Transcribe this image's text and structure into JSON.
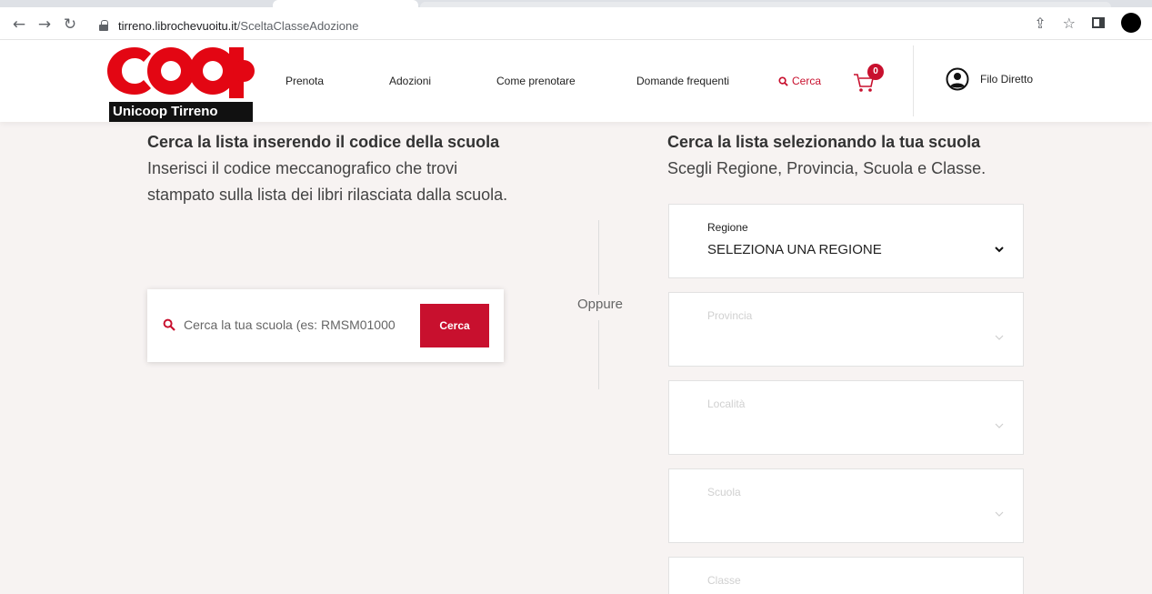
{
  "browser": {
    "url_host": "tirreno.librochevuoitu.it",
    "url_path": "/SceltaClasseAdozione",
    "back_icon": "arrow-left-icon",
    "forward_icon": "arrow-right-icon",
    "reload_icon": "reload-icon"
  },
  "header": {
    "logo_text": "coop",
    "logo_sub": "Unicoop Tirreno",
    "nav": {
      "prenota": "Prenota",
      "adozioni": "Adozioni",
      "come_prenotare": "Come prenotare",
      "domande": "Domande frequenti",
      "cerca": "Cerca"
    },
    "cart_count": "0",
    "filo_diretto": "Filo Diretto"
  },
  "left": {
    "title": "Cerca la lista inserendo il codice della scuola",
    "description": "Inserisci il codice meccanografico che trovi stampato sulla lista dei libri rilasciata dalla scuola.",
    "search_placeholder": "Cerca la tua scuola (es: RMSM01000",
    "search_button": "Cerca"
  },
  "divider": {
    "oppure": "Oppure"
  },
  "right": {
    "title": "Cerca la lista selezionando la tua scuola",
    "subtitle": "Scegli Regione, Provincia, Scuola e Classe.",
    "selects": [
      {
        "label": "Regione",
        "value": "SELEZIONA UNA REGIONE"
      },
      {
        "label": "Provincia",
        "value": ""
      },
      {
        "label": "Località",
        "value": ""
      },
      {
        "label": "Scuola",
        "value": ""
      },
      {
        "label": "Classe",
        "value": ""
      }
    ]
  },
  "colors": {
    "brand_red": "#c8102e",
    "background": "#f7f3f2"
  }
}
